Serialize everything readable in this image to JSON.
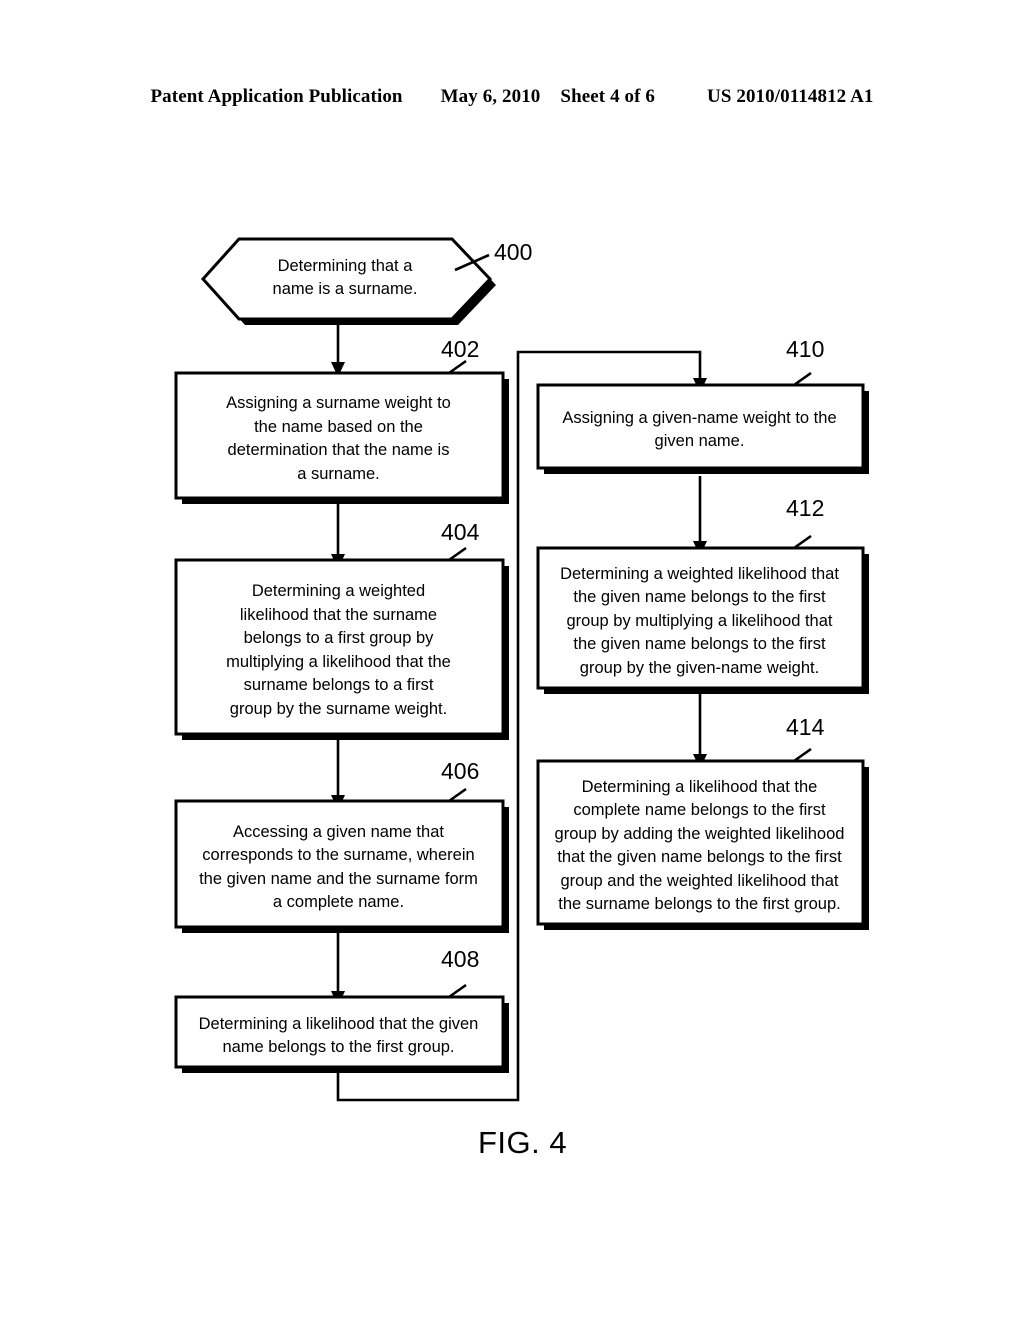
{
  "header": {
    "publication": "Patent Application Publication",
    "date": "May 6, 2010",
    "sheet": "Sheet 4 of 6",
    "document_number": "US 2010/0114812 A1"
  },
  "figure": {
    "caption": "FIG. 4",
    "ink_color": "#000000",
    "background_color": "#ffffff",
    "nodes": [
      {
        "ref": "400",
        "shape": "hexagon",
        "text": "Determining that a\nname is a surname."
      },
      {
        "ref": "402",
        "shape": "rectangle",
        "text": "Assigning a surname weight to\nthe name based on the\ndetermination that the name is\na surname."
      },
      {
        "ref": "404",
        "shape": "rectangle",
        "text": "Determining a weighted\nlikelihood that the surname\nbelongs to a first group by\nmultiplying a likelihood that the\nsurname belongs to a first\ngroup by the surname weight."
      },
      {
        "ref": "406",
        "shape": "rectangle",
        "text": "Accessing a given name that\ncorresponds to the surname, wherein\nthe given name and the surname form\na complete name."
      },
      {
        "ref": "408",
        "shape": "rectangle",
        "text": "Determining a likelihood that the given\nname belongs to the first group."
      },
      {
        "ref": "410",
        "shape": "rectangle",
        "text": "Assigning a given-name weight to the\ngiven name."
      },
      {
        "ref": "412",
        "shape": "rectangle",
        "text": "Determining a weighted likelihood that\nthe given name belongs to the first\ngroup by multiplying a likelihood that\nthe given name belongs to the first\ngroup by the given-name weight."
      },
      {
        "ref": "414",
        "shape": "rectangle",
        "text": "Determining a likelihood that the\ncomplete name belongs to the first\ngroup by adding the weighted likelihood\nthat the given name belongs to the first\ngroup and the weighted likelihood that\nthe surname belongs to the first group."
      }
    ]
  }
}
